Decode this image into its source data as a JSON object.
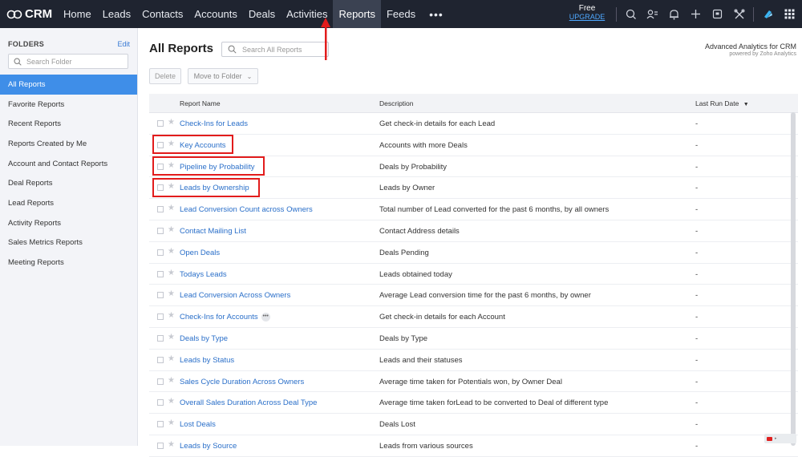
{
  "topbar": {
    "logo_text": "CRM",
    "nav": [
      {
        "label": "Home"
      },
      {
        "label": "Leads"
      },
      {
        "label": "Contacts"
      },
      {
        "label": "Accounts"
      },
      {
        "label": "Deals"
      },
      {
        "label": "Activities"
      },
      {
        "label": "Reports",
        "active": true
      },
      {
        "label": "Feeds"
      }
    ],
    "more_label": "•••",
    "plan_label": "Free",
    "upgrade_label": "UPGRADE"
  },
  "sidebar": {
    "title": "FOLDERS",
    "edit_label": "Edit",
    "search_placeholder": "Search Folder",
    "items": [
      {
        "label": "All Reports",
        "active": true
      },
      {
        "label": "Favorite Reports"
      },
      {
        "label": "Recent Reports"
      },
      {
        "label": "Reports Created by Me"
      },
      {
        "label": "Account and Contact Reports"
      },
      {
        "label": "Deal Reports"
      },
      {
        "label": "Lead Reports"
      },
      {
        "label": "Activity Reports"
      },
      {
        "label": "Sales Metrics Reports"
      },
      {
        "label": "Meeting Reports"
      }
    ]
  },
  "main": {
    "title": "All Reports",
    "search_placeholder": "Search All Reports",
    "analytics_title": "Advanced Analytics for CRM",
    "analytics_sub": "powered by Zoho Analytics",
    "delete_label": "Delete",
    "move_label": "Move to Folder",
    "columns": {
      "name": "Report Name",
      "description": "Description",
      "last_run": "Last Run Date"
    },
    "rows": [
      {
        "name": "Check-Ins for Leads",
        "description": "Get check-in details for each Lead",
        "last_run": "-"
      },
      {
        "name": "Key Accounts",
        "description": "Accounts with more Deals",
        "last_run": "-"
      },
      {
        "name": "Pipeline by Probability",
        "description": "Deals by Probability",
        "last_run": "-"
      },
      {
        "name": "Leads by Ownership",
        "description": "Leads by Owner",
        "last_run": "-"
      },
      {
        "name": "Lead Conversion Count across Owners",
        "description": "Total number of Lead converted for the past 6 months, by all owners",
        "last_run": "-"
      },
      {
        "name": "Contact Mailing List",
        "description": "Contact Address details",
        "last_run": "-"
      },
      {
        "name": "Open Deals",
        "description": "Deals Pending",
        "last_run": "-"
      },
      {
        "name": "Todays Leads",
        "description": "Leads obtained today",
        "last_run": "-"
      },
      {
        "name": "Lead Conversion Across Owners",
        "description": "Average Lead conversion time for the past 6 months, by owner",
        "last_run": "-"
      },
      {
        "name": "Check-Ins for Accounts",
        "description": "Get check-in details for each Account",
        "last_run": "-"
      },
      {
        "name": "Deals by Type",
        "description": "Deals by Type",
        "last_run": "-"
      },
      {
        "name": "Leads by Status",
        "description": "Leads and their statuses",
        "last_run": "-"
      },
      {
        "name": "Sales Cycle Duration Across Owners",
        "description": "Average time taken for Potentials won, by Owner Deal",
        "last_run": "-"
      },
      {
        "name": "Overall Sales Duration Across Deal Type",
        "description": "Average time taken forLead to be converted to Deal of different type",
        "last_run": "-"
      },
      {
        "name": "Lost Deals",
        "description": "Deals Lost",
        "last_run": "-"
      },
      {
        "name": "Leads by Source",
        "description": "Leads from various sources",
        "last_run": "-"
      }
    ]
  },
  "colors": {
    "topbar_bg": "#1f2430",
    "link": "#2a6fc9",
    "active_folder": "#3f8ee8",
    "annotation_red": "#e21c1c"
  }
}
